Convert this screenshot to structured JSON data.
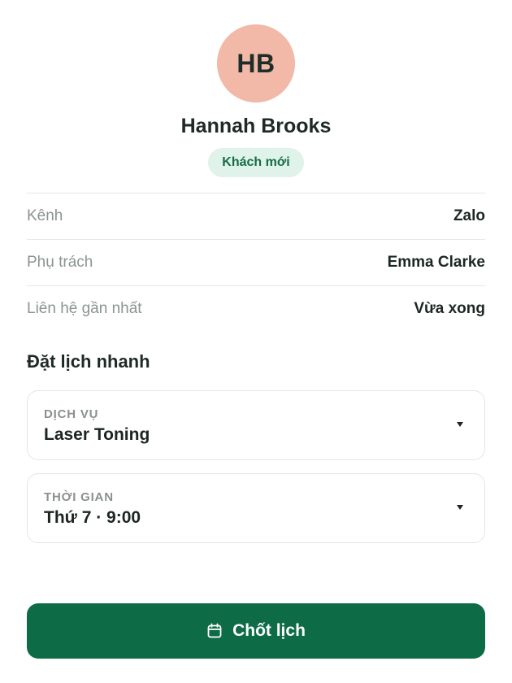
{
  "profile": {
    "initials": "HB",
    "name": "Hannah Brooks",
    "badge": "Khách mới",
    "avatar_color": "#f2b8a8"
  },
  "info": [
    {
      "label": "Kênh",
      "value": "Zalo"
    },
    {
      "label": "Phụ trách",
      "value": "Emma Clarke"
    },
    {
      "label": "Liên hệ gần nhất",
      "value": "Vừa xong"
    }
  ],
  "booking": {
    "title": "Đặt lịch nhanh",
    "service": {
      "label": "DỊCH VỤ",
      "value": "Laser Toning"
    },
    "time": {
      "label": "THỜI GIAN",
      "value": "Thứ 7 · 9:00"
    },
    "submit_label": "Chốt lịch",
    "submit_icon": "calendar-icon",
    "accent": "#0d6b46"
  }
}
